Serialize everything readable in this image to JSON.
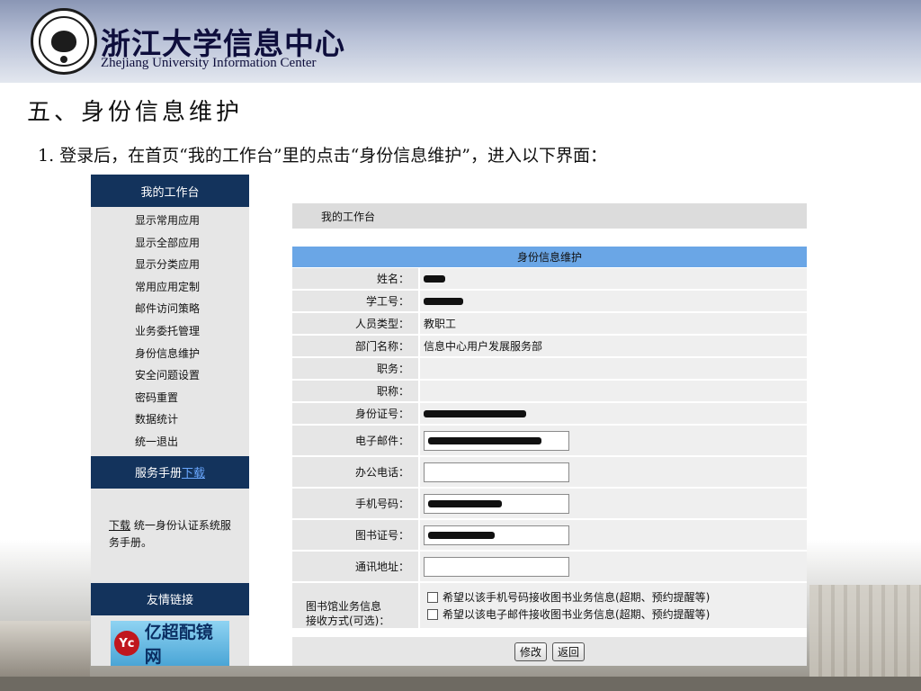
{
  "slide": {
    "org_name_cn": "浙江大学信息中心",
    "org_name_en": "Zhejiang University Information Center",
    "section_title": "五、身份信息维护",
    "instruction": "1. 登录后，在首页“我的工作台”里的点击“身份信息维护”，进入以下界面："
  },
  "sidebar": {
    "workbench_title": "我的工作台",
    "items": [
      "显示常用应用",
      "显示全部应用",
      "显示分类应用",
      "常用应用定制",
      "邮件访问策略",
      "业务委托管理",
      "身份信息维护",
      "安全问题设置",
      "密码重置",
      "数据统计",
      "统一退出"
    ],
    "manual_title": "服务手册",
    "manual_download_link": "下载",
    "manual_body_link": "下载",
    "manual_body_text": "统一身份认证系统服务手册。",
    "links_title": "友情链接",
    "banner_badge": "Yc",
    "banner_text": "亿超配镜网"
  },
  "main": {
    "breadcrumb": "我的工作台",
    "form_title": "身份信息维护",
    "fields": {
      "name_label": "姓名：",
      "staff_id_label": "学工号：",
      "person_type_label": "人员类型：",
      "person_type_value": "教职工",
      "dept_label": "部门名称：",
      "dept_value": "信息中心用户发展服务部",
      "position_label": "职务：",
      "title_label": "职称：",
      "id_card_label": "身份证号：",
      "email_label": "电子邮件：",
      "office_phone_label": "办公电话：",
      "mobile_label": "手机号码：",
      "library_card_label": "图书证号：",
      "address_label": "通讯地址：",
      "library_notify_label_1": "图书馆业务信息",
      "library_notify_label_2": "接收方式(可选)：",
      "notify_option_mobile": "希望以该手机号码接收图书业务信息(超期、预约提醒等)",
      "notify_option_email": "希望以该电子邮件接收图书业务信息(超期、预约提醒等)"
    },
    "buttons": {
      "modify": "修改",
      "back": "返回"
    }
  },
  "colors": {
    "nav_dark": "#13335c",
    "form_header": "#6aa6e6",
    "label_bg": "#e6e6e6"
  }
}
